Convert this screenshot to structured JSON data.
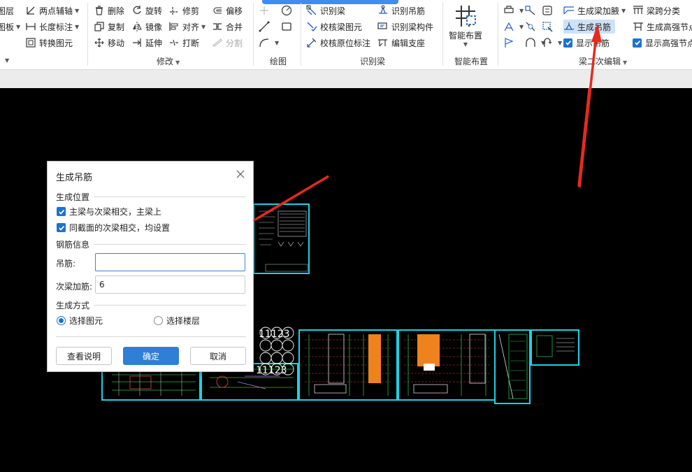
{
  "ribbon": {
    "groups": {
      "modify_label": "修改",
      "draw_label": "绘图",
      "identify_beam_label": "识别梁",
      "smart_layout_label": "智能布置",
      "beam_secondary_edit_label": "梁二次编辑"
    },
    "col1": {
      "layer": "图层",
      "board": "图板"
    },
    "axis": {
      "two_point_axis": "两点辅轴",
      "length_dim": "长度标注",
      "convert_element": "转换图元"
    },
    "modify": {
      "delete": "删除",
      "copy": "复制",
      "move": "移动",
      "rotate": "旋转",
      "mirror": "镜像",
      "extend": "延伸",
      "trim": "修剪",
      "align": "对齐",
      "break": "打断",
      "offset": "偏移",
      "merge": "合并",
      "split": "分割"
    },
    "identify_beam": {
      "identify_beam": "识别梁",
      "check_beam_element": "校核梁图元",
      "check_original_mark": "校核原位标注",
      "identify_hanger": "识别吊筋",
      "identify_beam_member": "识别梁构件",
      "edit_support": "编辑支座"
    },
    "smart_layout": {
      "label": "智能布置"
    },
    "beam_edit": {
      "gen_haunch": "生成梁加腋",
      "gen_hanger": "生成吊筋",
      "show_hanger": "显示吊筋",
      "span_classify": "梁跨分类",
      "gen_high_strength_node": "生成高强节点",
      "show_high_strength_node": "显示高强节点"
    }
  },
  "dialog": {
    "title": "生成吊筋",
    "section_position": "生成位置",
    "cb_main_secondary": "主梁与次梁相交，主梁上",
    "cb_same_section": "同截面的次梁相交，均设置",
    "section_rebar": "钢筋信息",
    "hanger_label": "吊筋:",
    "hanger_value": "",
    "secondary_add_label": "次梁加筋:",
    "secondary_add_value": "6",
    "section_method": "生成方式",
    "radio_select_element": "选择图元",
    "radio_select_floor": "选择楼层",
    "btn_help": "查看说明",
    "btn_ok": "确定",
    "btn_cancel": "取消"
  },
  "canvas": {
    "drawing_label_text": "11123"
  },
  "colors": {
    "accent": "#2f7fd7",
    "annotation_arrow": "#e52a1e",
    "drawing_frame": "#19d3e6",
    "canvas_bg": "#000000"
  }
}
